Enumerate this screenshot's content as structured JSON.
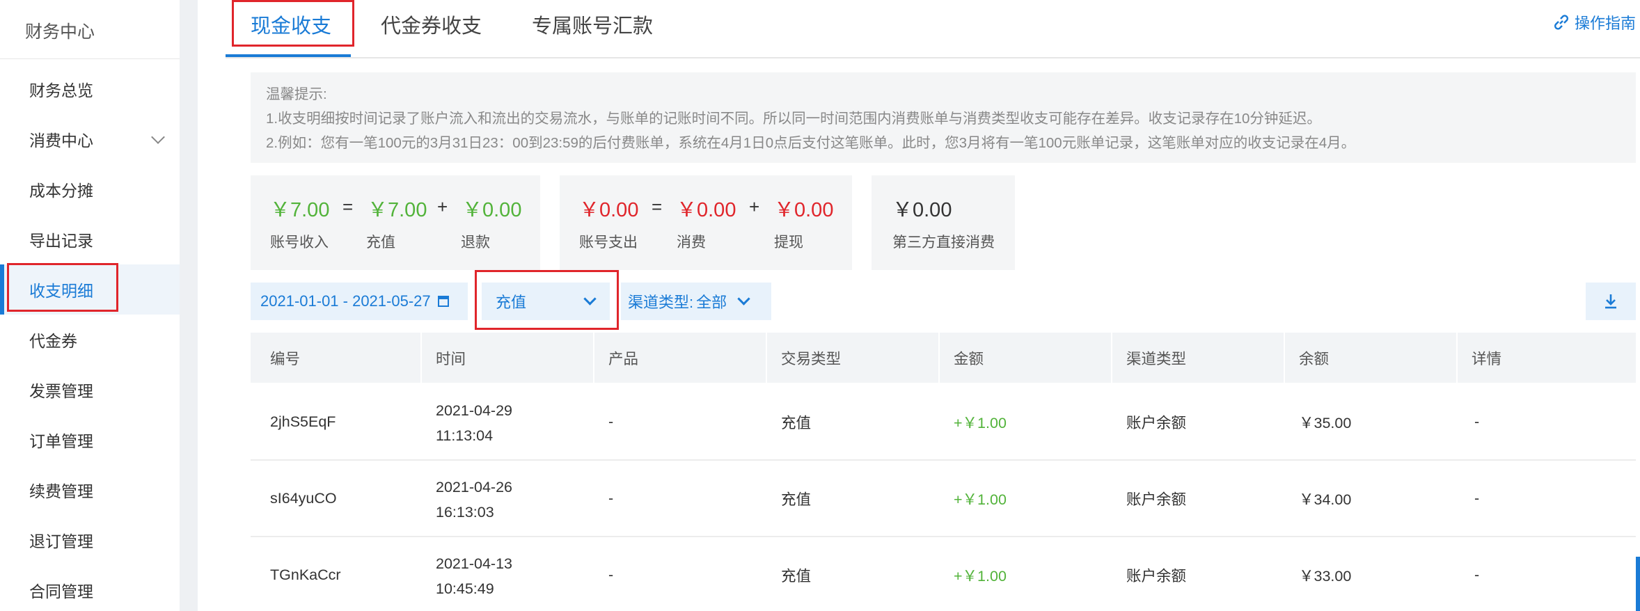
{
  "sidebar": {
    "title": "财务中心",
    "items": [
      {
        "label": "财务总览"
      },
      {
        "label": "消费中心"
      },
      {
        "label": "成本分摊"
      },
      {
        "label": "导出记录"
      },
      {
        "label": "收支明细"
      },
      {
        "label": "代金券"
      },
      {
        "label": "发票管理"
      },
      {
        "label": "订单管理"
      },
      {
        "label": "续费管理"
      },
      {
        "label": "退订管理"
      },
      {
        "label": "合同管理"
      }
    ],
    "active_item": "收支明细"
  },
  "tabs": [
    {
      "label": "现金收支"
    },
    {
      "label": "代金券收支"
    },
    {
      "label": "专属账号汇款"
    }
  ],
  "active_tab": "现金收支",
  "guide_label": "操作指南",
  "tips": {
    "heading": "温馨提示:",
    "line1": "1.收支明细按时间记录了账户流入和流出的交易流水，与账单的记账时间不同。所以同一时间范围内消费账单与消费类型收支可能存在差异。收支记录存在10分钟延迟。",
    "line2": "2.例如：您有一笔100元的3月31日23：00到23:59的后付费账单，系统在4月1日0点后支付这笔账单。此时，您3月将有一笔100元账单记录，这笔账单对应的收支记录在4月。"
  },
  "summary": {
    "income": {
      "total": "￥7.00",
      "total_label": "账号收入",
      "eq": "=",
      "a": "￥7.00",
      "a_label": "充值",
      "plus": "+",
      "b": "￥0.00",
      "b_label": "退款"
    },
    "expense": {
      "total": "￥0.00",
      "total_label": "账号支出",
      "eq": "=",
      "a": "￥0.00",
      "a_label": "消费",
      "plus": "+",
      "b": "￥0.00",
      "b_label": "提现"
    },
    "third_party": {
      "amount": "￥0.00",
      "label": "第三方直接消费"
    }
  },
  "filters": {
    "date_range": "2021-01-01 - 2021-05-27",
    "type_selected": "充值",
    "channel_label": "渠道类型:",
    "channel_selected": "全部"
  },
  "table": {
    "columns": [
      "编号",
      "时间",
      "产品",
      "交易类型",
      "金额",
      "渠道类型",
      "余额",
      "详情"
    ],
    "rows": [
      {
        "id": "2jhS5EqF",
        "date": "2021-04-29",
        "time": "11:13:04",
        "product": "-",
        "type": "充值",
        "amount": "+￥1.00",
        "channel": "账户余额",
        "balance": "￥35.00",
        "detail": "-"
      },
      {
        "id": "sI64yuCO",
        "date": "2021-04-26",
        "time": "16:13:03",
        "product": "-",
        "type": "充值",
        "amount": "+￥1.00",
        "channel": "账户余额",
        "balance": "￥34.00",
        "detail": "-"
      },
      {
        "id": "TGnKaCcr",
        "date": "2021-04-13",
        "time": "10:45:49",
        "product": "-",
        "type": "充值",
        "amount": "+￥1.00",
        "channel": "账户余额",
        "balance": "￥33.00",
        "detail": "-"
      }
    ]
  },
  "colors": {
    "accent": "#1a7bd6",
    "income": "#52b33a",
    "expense": "#e0252b",
    "highlight": "#e0252b"
  }
}
